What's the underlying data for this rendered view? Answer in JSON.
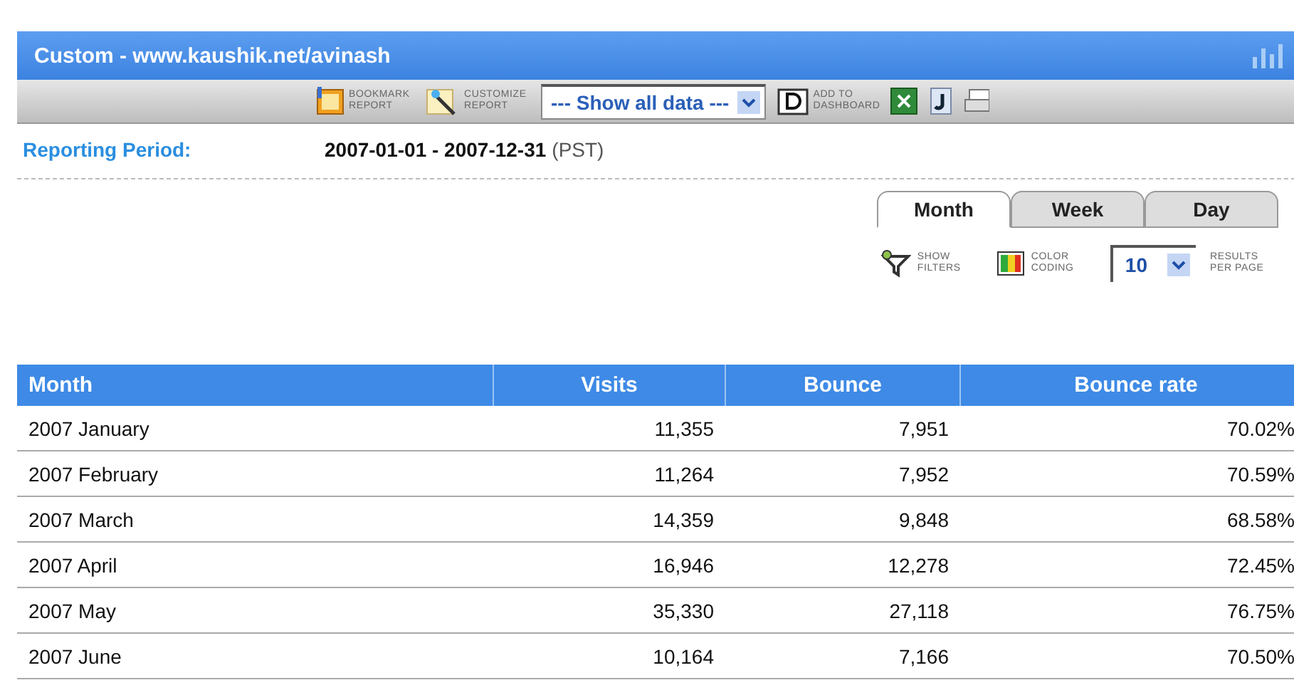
{
  "window": {
    "title": "Custom - www.kaushik.net/avinash"
  },
  "toolbar": {
    "bookmark": "BOOKMARK REPORT",
    "customize": "CUSTOMIZE REPORT",
    "view_select": "--- Show all data ---",
    "dashboard": "ADD TO DASHBOARD"
  },
  "reporting_period": {
    "label": "Reporting Period:",
    "range": "2007-01-01 - 2007-12-31",
    "timezone": "(PST)"
  },
  "tabs": [
    {
      "label": "Month",
      "selected": true
    },
    {
      "label": "Week",
      "selected": false
    },
    {
      "label": "Day",
      "selected": false
    }
  ],
  "options": {
    "filters": "SHOW FILTERS",
    "color_coding": "COLOR CODING",
    "per_page_value": "10",
    "per_page_label": "RESULTS PER PAGE"
  },
  "table": {
    "columns": [
      "Month",
      "Visits",
      "Bounce",
      "Bounce rate"
    ],
    "rows": [
      [
        "2007 January",
        "11,355",
        "7,951",
        "70.02%"
      ],
      [
        "2007 February",
        "11,264",
        "7,952",
        "70.59%"
      ],
      [
        "2007 March",
        "14,359",
        "9,848",
        "68.58%"
      ],
      [
        "2007 April",
        "16,946",
        "12,278",
        "72.45%"
      ],
      [
        "2007 May",
        "35,330",
        "27,118",
        "76.75%"
      ],
      [
        "2007 June",
        "10,164",
        "7,166",
        "70.50%"
      ]
    ]
  }
}
